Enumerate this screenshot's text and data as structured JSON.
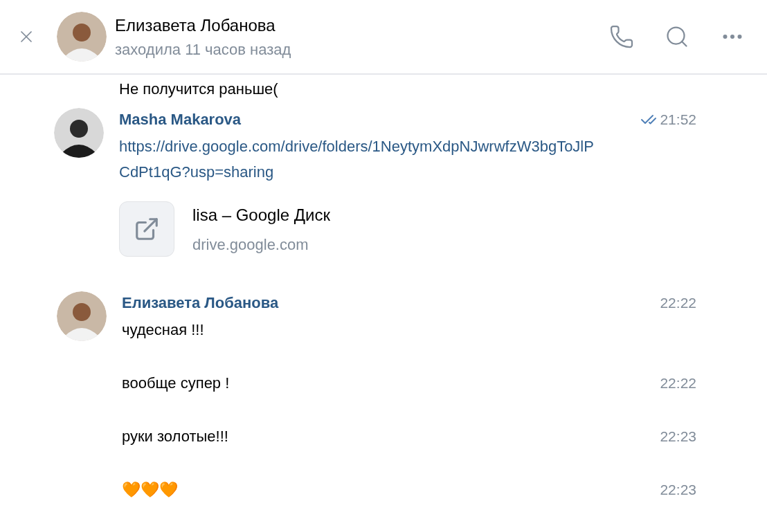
{
  "header": {
    "name": "Елизавета Лобанова",
    "status": "заходила 11 часов назад"
  },
  "partial_message": {
    "text": "Не получится раньше("
  },
  "messages": [
    {
      "author": "Masha Makarova",
      "time": "21:52",
      "read": true,
      "link": "https://drive.google.com/drive/folders/1NeytymXdpNJwrwfzW3bgToJlPCdPt1qG?usp=sharing",
      "card": {
        "title": "lisa – Google Диск",
        "domain": "drive.google.com"
      }
    },
    {
      "author": "Елизавета Лобанова",
      "time": "22:22",
      "lines": [
        {
          "text": "чудесная !!!"
        },
        {
          "text": "вообще супер !",
          "time": "22:22"
        },
        {
          "text": "руки золотые!!!",
          "time": "22:23"
        },
        {
          "text": "🧡🧡🧡",
          "time": "22:23"
        }
      ]
    }
  ]
}
